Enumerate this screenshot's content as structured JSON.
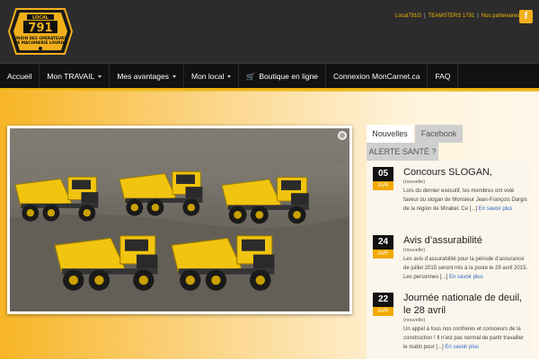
{
  "header": {
    "logo": {
      "word_local": "LOCAL",
      "number": "791",
      "line1": "UNION DES OPÉRATEURS",
      "line2": "DE MACHINERIE LOURDE",
      "badge_color": "#f1b01a"
    },
    "toplinks": [
      "Local791G",
      "TEAMSTERS 1791",
      "Nos partenaires"
    ],
    "facebook_glyph": "f"
  },
  "nav": {
    "items": [
      {
        "label": "Accueil",
        "dropdown": false
      },
      {
        "label": "Mon TRAVAIL",
        "dropdown": true
      },
      {
        "label": "Mes avantages",
        "dropdown": true
      },
      {
        "label": "Mon local",
        "dropdown": true
      },
      {
        "label": "Boutique en ligne",
        "dropdown": false,
        "icon": "cart-icon"
      },
      {
        "label": "Connexion MonCarnet.ca",
        "dropdown": false
      },
      {
        "label": "FAQ",
        "dropdown": false
      }
    ]
  },
  "slider": {
    "image": "six yellow articulated dump trucks"
  },
  "tabs": {
    "nouvelles": "Nouvelles",
    "facebook": "Facebook",
    "alerte": "ALERTE SANTÉ ?"
  },
  "news": [
    {
      "day": "05",
      "month": "AVR",
      "title": "Concours SLOGAN,",
      "category": "(nouvelle)",
      "text": "Lors du dernier exécutif, les membres ont voté faveur du slogan de Monsieur Jean-François Dargis de la région de Mirabel. Ce [...]",
      "more": "En savoir plus"
    },
    {
      "day": "24",
      "month": "AVR",
      "title": "Avis d’assurabilité",
      "category": "(nouvelle)",
      "text": "Les avis d’assurabilité pour la période d’assurance de juillet 2015 seront mis à la poste le 29 avril 2015. Les personnes [...]",
      "more": "En savoir plus"
    },
    {
      "day": "22",
      "month": "AVR",
      "title": "Journée nationale de deuil, le 28 avril",
      "category": "(nouvelle)",
      "text": "Un appel à tous nos confrères et consoeurs de la construction ! Il n’est pas normal de partir travailler le matin pour [...]",
      "more": "En savoir plus"
    }
  ]
}
